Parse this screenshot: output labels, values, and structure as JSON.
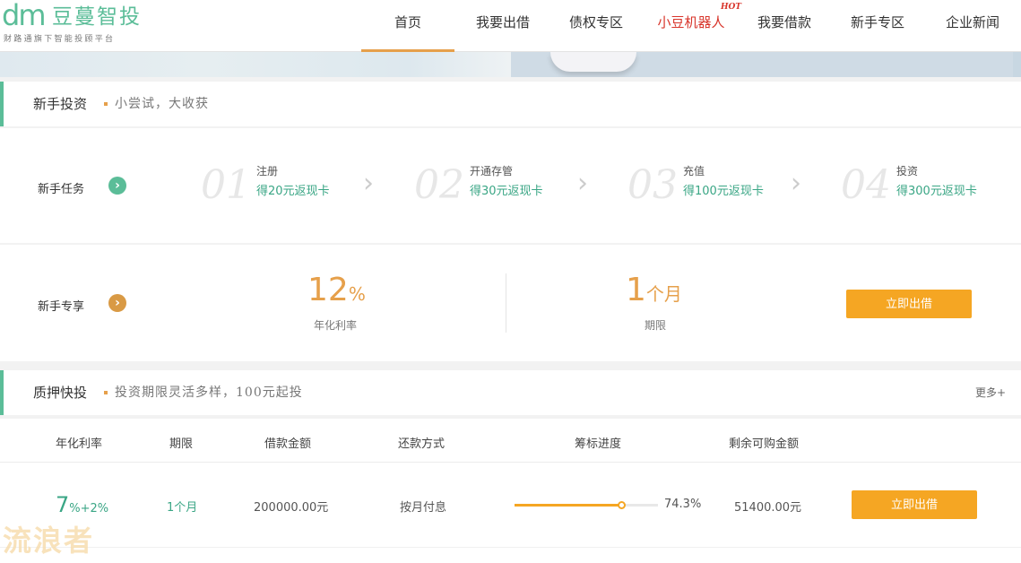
{
  "logo": {
    "mark": "dm",
    "name": "豆蔓智投",
    "slogan": "财路通旗下智能投顾平台"
  },
  "nav": {
    "items": [
      {
        "label": "首页"
      },
      {
        "label": "我要出借"
      },
      {
        "label": "债权专区"
      },
      {
        "label": "小豆机器人",
        "badge": "HOT"
      },
      {
        "label": "我要借款"
      },
      {
        "label": "新手专区"
      },
      {
        "label": "企业新闻"
      }
    ]
  },
  "newbie": {
    "title": "新手投资",
    "subtitle": "小尝试，大收获",
    "tasks": {
      "label": "新手任务",
      "steps": [
        {
          "num": "01",
          "name": "注册",
          "reward": "得20元返现卡"
        },
        {
          "num": "02",
          "name": "开通存管",
          "reward": "得30元返现卡"
        },
        {
          "num": "03",
          "name": "充值",
          "reward": "得100元返现卡"
        },
        {
          "num": "04",
          "name": "投资",
          "reward": "得300元返现卡"
        }
      ]
    },
    "exclusive": {
      "label": "新手专享",
      "rate": "12",
      "rate_unit": "%",
      "rate_caption": "年化利率",
      "term": "1",
      "term_unit": "个月",
      "term_caption": "期限",
      "button": "立即出借"
    }
  },
  "pledge": {
    "title": "质押快投",
    "subtitle": "投资期限灵活多样，100元起投",
    "more": "更多+",
    "columns": [
      "年化利率",
      "期限",
      "借款金额",
      "还款方式",
      "筹标进度",
      "剩余可购金额"
    ],
    "row": {
      "rate": "7",
      "rate_extra": "%+2%",
      "term": "1个月",
      "amount": "200000.00元",
      "repayment": "按月付息",
      "progress": 0.743,
      "progress_text": "74.3%",
      "remaining": "51400.00元",
      "button": "立即出借"
    }
  },
  "watermark": "流浪者",
  "colors": {
    "accent_green": "#5bbd98",
    "accent_orange": "#f5a623",
    "hot_red": "#d8352b"
  }
}
